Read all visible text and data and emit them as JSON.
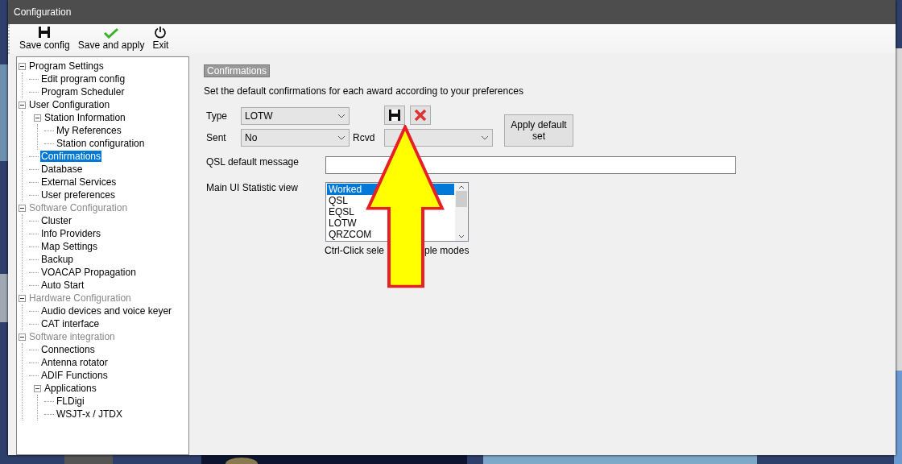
{
  "window": {
    "title": "Configuration"
  },
  "toolbar": [
    {
      "kind": "save",
      "label": "Save config"
    },
    {
      "kind": "apply",
      "label": "Save and apply"
    },
    {
      "kind": "exit",
      "label": "Exit"
    }
  ],
  "tree": [
    {
      "label": "Program Settings",
      "greyed": false,
      "selected": false,
      "children": [
        {
          "label": "Edit program config",
          "greyed": false,
          "selected": false
        },
        {
          "label": "Program Scheduler",
          "greyed": false,
          "selected": false
        }
      ]
    },
    {
      "label": "User Configuration",
      "greyed": false,
      "selected": false,
      "children": [
        {
          "label": "Station Information",
          "greyed": false,
          "selected": false,
          "children": [
            {
              "label": "My References",
              "greyed": false,
              "selected": false
            },
            {
              "label": "Station configuration",
              "greyed": false,
              "selected": false
            }
          ]
        },
        {
          "label": "Confirmations",
          "greyed": false,
          "selected": true
        },
        {
          "label": "Database",
          "greyed": false,
          "selected": false
        },
        {
          "label": "External Services",
          "greyed": false,
          "selected": false
        },
        {
          "label": "User preferences",
          "greyed": false,
          "selected": false
        }
      ]
    },
    {
      "label": "Software Configuration",
      "greyed": true,
      "selected": false,
      "children": [
        {
          "label": "Cluster",
          "greyed": false,
          "selected": false
        },
        {
          "label": "Info Providers",
          "greyed": false,
          "selected": false
        },
        {
          "label": "Map Settings",
          "greyed": false,
          "selected": false
        },
        {
          "label": "Backup",
          "greyed": false,
          "selected": false
        },
        {
          "label": "VOACAP Propagation",
          "greyed": false,
          "selected": false
        },
        {
          "label": "Auto Start",
          "greyed": false,
          "selected": false
        }
      ]
    },
    {
      "label": "Hardware Configuration",
      "greyed": true,
      "selected": false,
      "children": [
        {
          "label": "Audio devices and voice keyer",
          "greyed": false,
          "selected": false
        },
        {
          "label": "CAT interface",
          "greyed": false,
          "selected": false
        }
      ]
    },
    {
      "label": "Software integration",
      "greyed": true,
      "selected": false,
      "children": [
        {
          "label": "Connections",
          "greyed": false,
          "selected": false
        },
        {
          "label": "Antenna rotator",
          "greyed": false,
          "selected": false
        },
        {
          "label": "ADIF Functions",
          "greyed": false,
          "selected": false
        },
        {
          "label": "Applications",
          "greyed": false,
          "selected": false,
          "children": [
            {
              "label": "FLDigi",
              "greyed": false,
              "selected": false
            },
            {
              "label": "WSJT-x / JTDX",
              "greyed": false,
              "selected": false
            }
          ]
        }
      ]
    }
  ],
  "panel": {
    "heading": "Confirmations",
    "description": "Set the default confirmations for each award according to your preferences",
    "type": {
      "label": "Type",
      "value": "LOTW"
    },
    "sent": {
      "label": "Sent",
      "value": "No"
    },
    "rcvd": {
      "label": "Rcvd"
    },
    "apply_button": "Apply default set",
    "qsl_message": {
      "label": "QSL default message"
    },
    "statistic_view": {
      "label": "Main UI Statistic view",
      "items": [
        {
          "label": "Worked",
          "selected": true
        },
        {
          "label": "QSL",
          "selected": false
        },
        {
          "label": "EQSL",
          "selected": false
        },
        {
          "label": "LOTW",
          "selected": false
        },
        {
          "label": "QRZCOM",
          "selected": false
        }
      ]
    },
    "hint_parts": [
      "Ctrl-Click sele",
      "ple modes"
    ]
  }
}
